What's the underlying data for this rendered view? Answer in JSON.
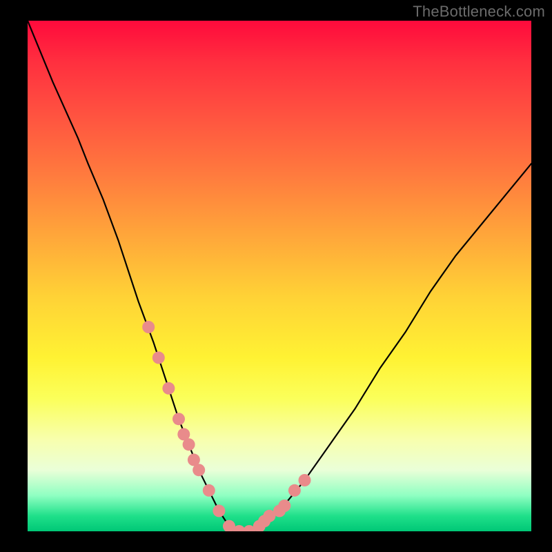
{
  "watermark": "TheBottleneck.com",
  "chart_data": {
    "type": "line",
    "title": "",
    "xlabel": "",
    "ylabel": "",
    "xlim": [
      0,
      100
    ],
    "ylim": [
      0,
      100
    ],
    "grid": false,
    "series": [
      {
        "name": "bottleneck-curve",
        "x": [
          0,
          5,
          10,
          12,
          15,
          18,
          20,
          22,
          25,
          28,
          30,
          32,
          34,
          36,
          38,
          40,
          42,
          44,
          46,
          50,
          55,
          60,
          65,
          70,
          75,
          80,
          85,
          90,
          95,
          100
        ],
        "y": [
          100,
          88,
          77,
          72,
          65,
          57,
          51,
          45,
          37,
          28,
          22,
          17,
          12,
          8,
          4,
          1,
          0,
          0,
          1,
          4,
          10,
          17,
          24,
          32,
          39,
          47,
          54,
          60,
          66,
          72
        ]
      }
    ],
    "highlight_points": {
      "name": "pink-markers",
      "x": [
        24,
        26,
        28,
        30,
        31,
        32,
        33,
        34,
        36,
        38,
        40,
        42,
        44,
        46,
        47,
        48,
        50,
        51,
        53,
        55
      ],
      "y": [
        40,
        34,
        28,
        22,
        19,
        17,
        14,
        12,
        8,
        4,
        1,
        0,
        0,
        1,
        2,
        3,
        4,
        5,
        8,
        10
      ]
    },
    "gradient_stops": [
      {
        "pos": 0.0,
        "color": "#ff0a3c"
      },
      {
        "pos": 0.18,
        "color": "#ff5140"
      },
      {
        "pos": 0.42,
        "color": "#ffa63a"
      },
      {
        "pos": 0.66,
        "color": "#fff233"
      },
      {
        "pos": 0.88,
        "color": "#eaffd8"
      },
      {
        "pos": 1.0,
        "color": "#00c776"
      }
    ]
  }
}
